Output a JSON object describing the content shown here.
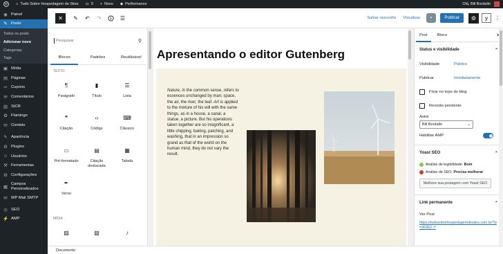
{
  "admin_bar": {
    "site_name": "Tudo Sobre Hospedagem de Sites",
    "comments_count": "0",
    "new_label": "Novo",
    "performance_label": "Performance",
    "greeting": "Olá, Bill Bordallo"
  },
  "sidebar": {
    "items": [
      {
        "icon": "dashboard-icon",
        "glyph": "◉",
        "label": "Painel"
      },
      {
        "icon": "pin-icon",
        "glyph": "✎",
        "label": "Posts"
      },
      {
        "icon": "media-icon",
        "glyph": "▣",
        "label": "Mídia"
      },
      {
        "icon": "pages-icon",
        "glyph": "▤",
        "label": "Páginas"
      },
      {
        "icon": "coupon-icon",
        "glyph": "✂",
        "label": "Cupons"
      },
      {
        "icon": "comments-icon",
        "glyph": "✉",
        "label": "Comentários"
      },
      {
        "icon": "chart-icon",
        "glyph": "▥",
        "label": "StCR"
      },
      {
        "icon": "flamingo-icon",
        "glyph": "✿",
        "label": "Flamingo"
      },
      {
        "icon": "contact-icon",
        "glyph": "✉",
        "label": "Contato"
      },
      {
        "icon": "appearance-icon",
        "glyph": "✎",
        "label": "Aparência"
      },
      {
        "icon": "plugins-icon",
        "glyph": "⚙",
        "label": "Plugins"
      },
      {
        "icon": "users-icon",
        "glyph": "☺",
        "label": "Usuários"
      },
      {
        "icon": "tools-icon",
        "glyph": "⚒",
        "label": "Ferramentas"
      },
      {
        "icon": "settings-icon",
        "glyph": "⚙",
        "label": "Configurações"
      },
      {
        "icon": "custom-fields-icon",
        "glyph": "▦",
        "label": "Campos Personalizados"
      },
      {
        "icon": "mail-icon",
        "glyph": "✉",
        "label": "WP Mail SMTP"
      },
      {
        "icon": "seo-icon",
        "glyph": "◎",
        "label": "SEO"
      },
      {
        "icon": "amp-icon",
        "glyph": "⚡",
        "label": "AMP"
      }
    ],
    "submenu": [
      "Todos os posts",
      "Adicionar novo",
      "Categorias",
      "Tags"
    ]
  },
  "header": {
    "save_draft": "Salvar rascunho",
    "preview": "Visualizar",
    "publish": "Publicar"
  },
  "inserter": {
    "search_placeholder": "Pesquisar",
    "tabs": [
      "Blocos",
      "Padrões",
      "Reutilizável"
    ],
    "category_text": "Texto",
    "category_media": "Mídia",
    "blocks": [
      {
        "icon": "paragraph-icon",
        "glyph": "¶",
        "label": "Parágrafo"
      },
      {
        "icon": "heading-icon",
        "glyph": "🔖",
        "label": "Título"
      },
      {
        "icon": "list-icon",
        "glyph": "☰",
        "label": "Lista"
      },
      {
        "icon": "quote-icon",
        "glyph": "❞",
        "label": "Citação"
      },
      {
        "icon": "code-icon",
        "glyph": "‹›",
        "label": "Código"
      },
      {
        "icon": "classic-icon",
        "glyph": "⌨",
        "label": "Clássico"
      },
      {
        "icon": "preformatted-icon",
        "glyph": "▭",
        "label": "Pré-formatado"
      },
      {
        "icon": "pullquote-icon",
        "glyph": "▤",
        "label": "Citação destacada"
      },
      {
        "icon": "table-icon",
        "glyph": "▦",
        "label": "Tabela"
      },
      {
        "icon": "verse-icon",
        "glyph": "✒",
        "label": "Verso"
      }
    ],
    "media_blocks": [
      {
        "icon": "image-icon",
        "glyph": "▨",
        "label": ""
      },
      {
        "icon": "gallery-icon",
        "glyph": "▧",
        "label": ""
      },
      {
        "icon": "audio-icon",
        "glyph": "♪",
        "label": ""
      }
    ]
  },
  "canvas": {
    "title": "Apresentando o editor Gutenberg",
    "paragraph": {
      "em1": "Nature",
      "t1": ", in the common sense, refers to essences unchanged by man; space, the air, the river, the leaf. ",
      "em2": "Art",
      "t2": " is applied to the mixture of his will with the same things, as in a house, a canal, a statue, a picture. But his operations taken together are so insignificant, a little chipping, baking, patching, and washing, that in an impression so grand as that of the world on the human mind, they do not vary the result."
    }
  },
  "settings": {
    "tabs": [
      "Post",
      "Bloco"
    ],
    "status_title": "Status e visibilidade",
    "visibility_label": "Visibilidade",
    "visibility_value": "Público",
    "publish_label": "Publicar",
    "publish_value": "Imediatamente",
    "sticky_label": "Fixar no topo do blog",
    "pending_label": "Revisão pendente",
    "author_label": "Autor",
    "author_value": "Bill Bordallo",
    "amp_label": "Habilitar AMP",
    "yoast_title": "Yoast SEO",
    "readability_prefix": "Análise de legibilidade:",
    "readability_value": "Bom",
    "seo_prefix": "Análise de SEO:",
    "seo_value": "Precisa melhorar",
    "yoast_button": "Melhore sua postagem com Yoast SEO",
    "permalink_title": "Link permanente",
    "view_post": "Ver Post",
    "permalink_url": "https://tudosobrehospedagemdesites.com.br/?p=30363",
    "status_colors": {
      "good": "#7ad03a",
      "needs_improvement": "#dc3232"
    }
  },
  "footer": {
    "breadcrumb": "Documento"
  },
  "colors": {
    "accent": "#2271b1",
    "admin_dark": "#1d2327",
    "media_block_bg": "#f6f2e3"
  }
}
